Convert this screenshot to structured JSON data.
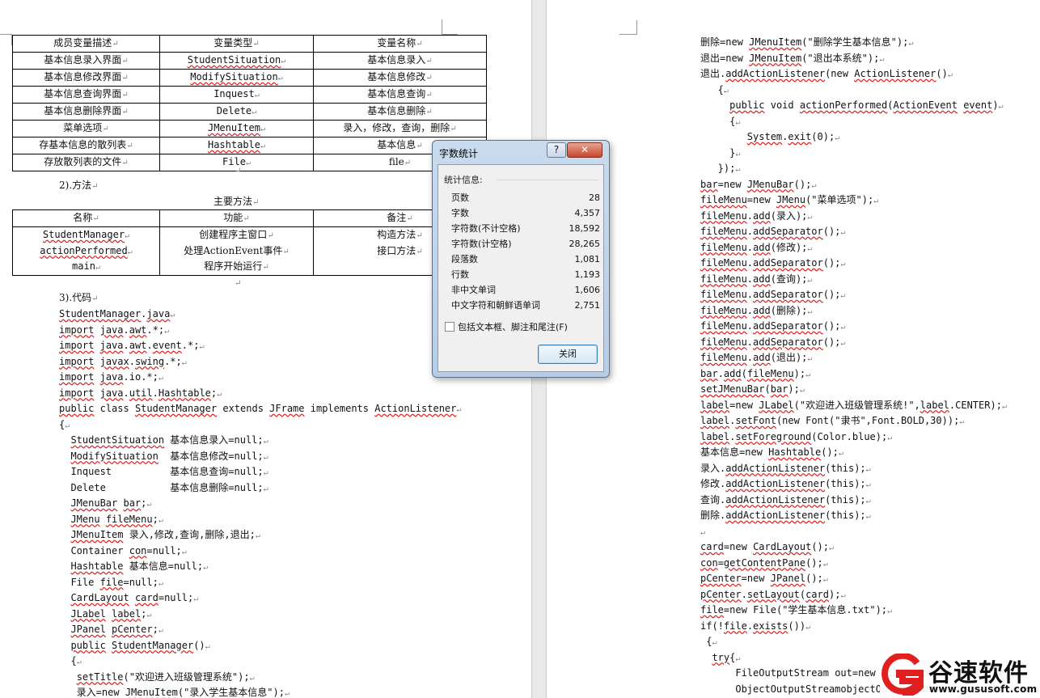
{
  "left": {
    "table1": {
      "headers": [
        "成员变量描述",
        "变量类型",
        "变量名称"
      ],
      "rows": [
        [
          "基本信息录入界面",
          "StudentSituation",
          "基本信息录入"
        ],
        [
          "基本信息修改界面",
          "ModifySituation",
          "基本信息修改"
        ],
        [
          "基本信息查询界面",
          "Inquest",
          "基本信息查询"
        ],
        [
          "基本信息删除界面",
          "Delete",
          "基本信息删除"
        ],
        [
          "菜单选项",
          "JMenuItem",
          "录入，修改，查询，删除"
        ],
        [
          "存基本信息的散列表",
          "Hashtable",
          "基本信息"
        ],
        [
          "存放散列表的文件",
          "File",
          "file"
        ]
      ]
    },
    "section2": "2).方法",
    "table2_caption": "主要方法",
    "table2": {
      "headers": [
        "名称",
        "功能",
        "备注"
      ],
      "col1": [
        "StudentManager",
        "actionPerformed",
        "main"
      ],
      "col2": [
        "创建程序主窗口",
        "处理ActionEvent事件",
        "程序开始运行"
      ],
      "col3": [
        "构造方法",
        "接口方法"
      ]
    },
    "section3": "3).代码",
    "code": [
      "StudentManager.java",
      "import java.awt.*;",
      "import java.awt.event.*;",
      "import javax.swing.*;",
      "import java.io.*;",
      "import java.util.Hashtable;",
      "public class StudentManager extends JFrame implements ActionListener",
      "{",
      "  StudentSituation 基本信息录入=null;",
      "  ModifySituation  基本信息修改=null;",
      "  Inquest          基本信息查询=null;",
      "  Delete           基本信息删除=null;",
      "  JMenuBar bar;",
      "  JMenu fileMenu;",
      "  JMenuItem 录入,修改,查询,删除,退出;",
      "  Container con=null;",
      "  Hashtable 基本信息=null;",
      "  File file=null;",
      "  CardLayout card=null;",
      "  JLabel label;",
      "  JPanel pCenter;",
      "  public StudentManager()",
      "  {",
      "   setTitle(\"欢迎进入班级管理系统\");",
      "   录入=new JMenuItem(\"录入学生基本信息\");"
    ]
  },
  "right": {
    "code": [
      "删除=new JMenuItem(\"删除学生基本信息\");",
      "退出=new JMenuItem(\"退出本系统\");",
      "退出.addActionListener(new ActionListener()",
      "   {",
      "     public void actionPerformed(ActionEvent event)",
      "     {",
      "        System.exit(0);",
      "     }",
      "   });",
      "bar=new JMenuBar();",
      "fileMenu=new JMenu(\"菜单选项\");",
      "fileMenu.add(录入);",
      "fileMenu.addSeparator();",
      "fileMenu.add(修改);",
      "fileMenu.addSeparator();",
      "fileMenu.add(查询);",
      "fileMenu.addSeparator();",
      "fileMenu.add(删除);",
      "fileMenu.addSeparator();",
      "fileMenu.addSeparator();",
      "fileMenu.add(退出);",
      "bar.add(fileMenu);",
      "setJMenuBar(bar);",
      "label=new JLabel(\"欢迎进入班级管理系统!\",label.CENTER);",
      "label.setFont(new Font(\"隶书\",Font.BOLD,30));",
      "label.setForeground(Color.blue);",
      "基本信息=new Hashtable();",
      "录入.addActionListener(this);",
      "修改.addActionListener(this);",
      "查询.addActionListener(this);",
      "删除.addActionListener(this);",
      "",
      "card=new CardLayout();",
      "con=getContentPane();",
      "pCenter=new JPanel();",
      "pCenter.setLayout(card);",
      "file=new File(\"学生基本信息.txt\");",
      "if(!file.exists())",
      " {",
      "  try{",
      "      FileOutputStream out=new FileOutputStream(file);",
      "      ObjectOutputStreamobjectOut=new ObjectOutputStream(out);"
    ]
  },
  "dialog": {
    "title": "字数统计",
    "help_label": "?",
    "close_label": "✕",
    "group_label": "统计信息:",
    "stats": [
      {
        "label": "页数",
        "value": "28"
      },
      {
        "label": "字数",
        "value": "4,357"
      },
      {
        "label": "字符数(不计空格)",
        "value": "18,592"
      },
      {
        "label": "字符数(计空格)",
        "value": "28,265"
      },
      {
        "label": "段落数",
        "value": "1,081"
      },
      {
        "label": "行数",
        "value": "1,193"
      },
      {
        "label": "非中文单词",
        "value": "1,606"
      },
      {
        "label": "中文字符和朝鲜语单词",
        "value": "2,751"
      }
    ],
    "checkbox_label": "包括文本框、脚注和尾注(F)",
    "checkbox_checked": false,
    "button_label": "关闭"
  },
  "watermark": {
    "name": "谷速软件",
    "url": "www.gususoft.com"
  }
}
